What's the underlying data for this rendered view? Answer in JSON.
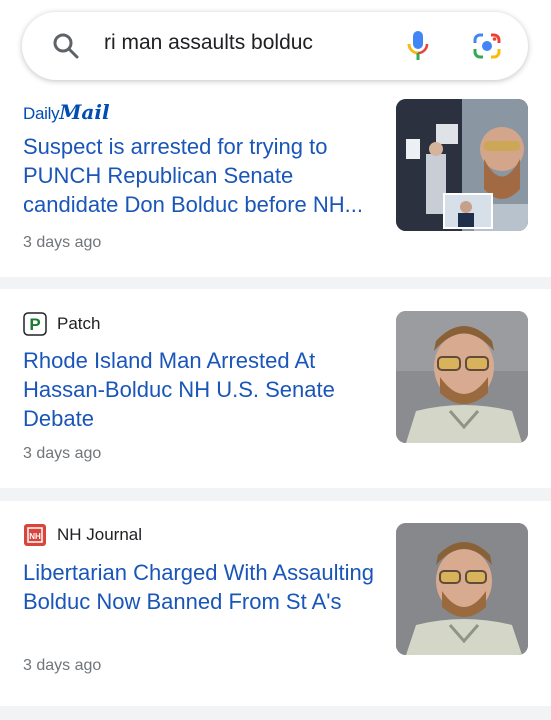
{
  "search": {
    "query": "ri man assaults bolduc",
    "icons": [
      "search-icon",
      "mic-icon",
      "google-lens-icon"
    ]
  },
  "results": [
    {
      "source": "Daily Mail",
      "source_logo_parts": [
        "Daily",
        "Mail"
      ],
      "title": "Suspect is arrested for trying to PUNCH Republican Senate candidate Don Bolduc before NH...",
      "time": "3 days ago"
    },
    {
      "source": "Patch",
      "source_icon_letter": "P",
      "title": "Rhode Island Man Arrested At Hassan-Bolduc NH U.S. Senate Debate",
      "time": "3 days ago"
    },
    {
      "source": "NH Journal",
      "source_icon_letter": "NH",
      "title": "Libertarian Charged With Assaulting Bolduc Now Banned From St A's",
      "time": "3 days ago"
    }
  ],
  "colors": {
    "link": "#1a56b9",
    "meta": "#70757a",
    "background": "#f1f3f4",
    "patch_green": "#1b7a2e",
    "nhjournal_red": "#d9443b"
  }
}
